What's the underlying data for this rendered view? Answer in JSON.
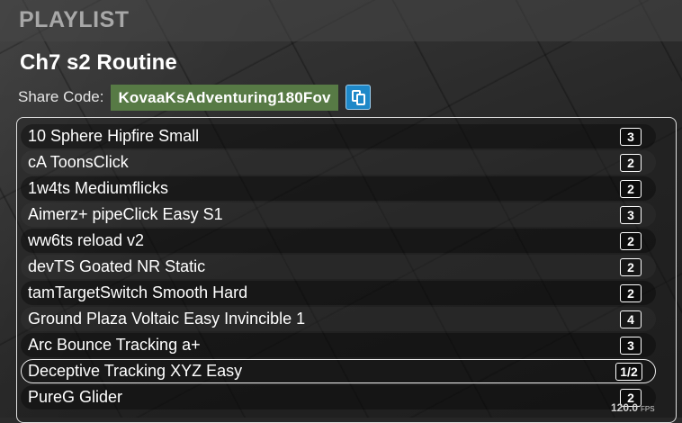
{
  "header": {
    "title": "PLAYLIST"
  },
  "playlist": {
    "name": "Ch7 s2 Routine",
    "share_label": "Share Code:",
    "share_code": "KovaaKsAdventuring180Fov",
    "copy_icon": "copy-icon"
  },
  "scenarios": [
    {
      "name": "10 Sphere Hipfire Small",
      "count": "3"
    },
    {
      "name": "cA ToonsClick",
      "count": "2"
    },
    {
      "name": "1w4ts Mediumflicks",
      "count": "2"
    },
    {
      "name": "Aimerz+ pipeClick Easy S1",
      "count": "3"
    },
    {
      "name": "ww6ts reload v2",
      "count": "2"
    },
    {
      "name": "devTS Goated NR Static",
      "count": "2"
    },
    {
      "name": "tamTargetSwitch Smooth Hard",
      "count": "2"
    },
    {
      "name": "Ground Plaza Voltaic Easy Invincible 1",
      "count": "4"
    },
    {
      "name": "Arc Bounce Tracking a+",
      "count": "3"
    },
    {
      "name": "Deceptive Tracking XYZ Easy",
      "count": "1/2",
      "selected": true
    },
    {
      "name": "PureG Glider",
      "count": "2"
    }
  ],
  "fps": {
    "value": "120.0",
    "unit": "FPS"
  },
  "colors": {
    "share_code_bg": "#577a45",
    "copy_button_bg": "#1e88c8",
    "header_text": "#a8a8a8"
  }
}
